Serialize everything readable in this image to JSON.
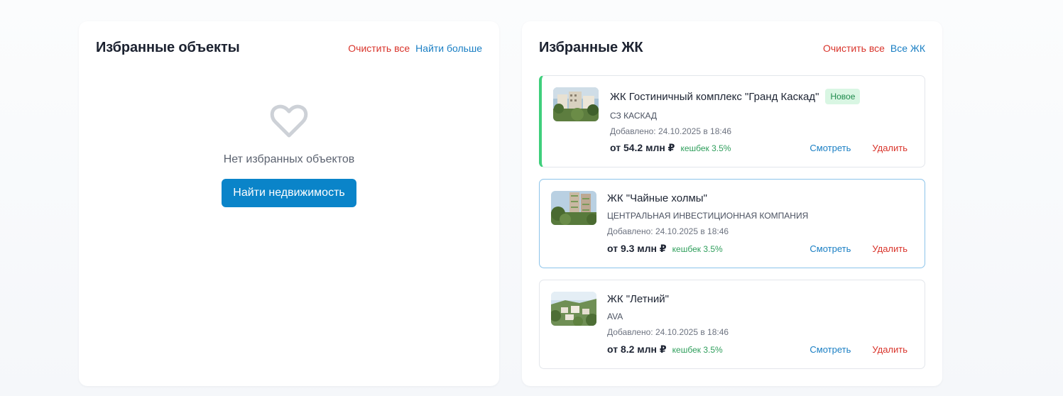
{
  "favorites_objects": {
    "title": "Избранные объекты",
    "clear_all": "Очистить все",
    "find_more": "Найти больше",
    "empty_text": "Нет избранных объектов",
    "find_button": "Найти недвижимость"
  },
  "favorites_complexes": {
    "title": "Избранные ЖК",
    "clear_all": "Очистить все",
    "all_link": "Все ЖК",
    "items": [
      {
        "name": "ЖК Гостиничный комплекс \"Гранд Каскад\"",
        "badge": "Новое",
        "developer": "СЗ КАСКАД",
        "added": "Добавлено: 24.10.2025 в 18:46",
        "price": "от 54.2 млн ₽",
        "cashback": "кешбек 3.5%",
        "view": "Смотреть",
        "delete": "Удалить"
      },
      {
        "name": "ЖК \"Чайные холмы\"",
        "developer": "ЦЕНТРАЛЬНАЯ ИНВЕСТИЦИОННАЯ КОМПАНИЯ",
        "added": "Добавлено: 24.10.2025 в 18:46",
        "price": "от 9.3 млн ₽",
        "cashback": "кешбек 3.5%",
        "view": "Смотреть",
        "delete": "Удалить"
      },
      {
        "name": "ЖК \"Летний\"",
        "developer": "AVA",
        "added": "Добавлено: 24.10.2025 в 18:46",
        "price": "от 8.2 млн ₽",
        "cashback": "кешбек 3.5%",
        "view": "Смотреть",
        "delete": "Удалить"
      }
    ]
  },
  "colors": {
    "accent_blue": "#0a84c9",
    "link_red": "#d9342b",
    "link_blue": "#1a7fc4",
    "new_badge_bg": "#d9f6e3",
    "cashback_green": "#2e9e5b"
  }
}
